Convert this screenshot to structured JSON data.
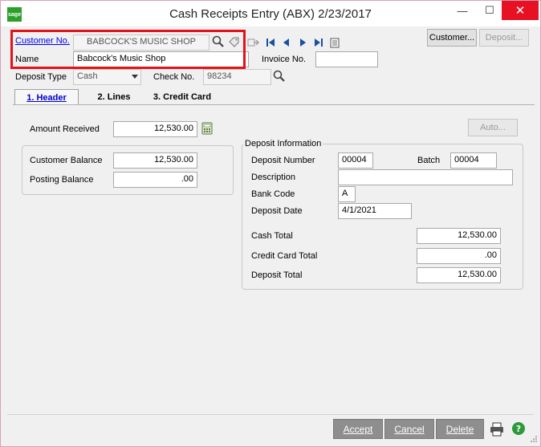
{
  "window": {
    "logo": "sage",
    "title": "Cash Receipts Entry (ABX) 2/23/2017",
    "min_glyph": "—",
    "max_glyph": "☐",
    "close_glyph": "✕"
  },
  "header": {
    "customer_no_label": "Customer No.",
    "customer_no_value": "BABCOCK'S MUSIC SHOP",
    "name_label": "Name",
    "name_value": "Babcock's Music Shop",
    "invoice_no_label": "Invoice No.",
    "invoice_no_value": "",
    "deposit_type_label": "Deposit Type",
    "deposit_type_value": "Cash",
    "check_no_label": "Check No.",
    "check_no_value": "98234",
    "customer_button": "Customer...",
    "deposit_button": "Deposit..."
  },
  "tabs": [
    {
      "label": "1. Header",
      "active": true
    },
    {
      "label": "2. Lines",
      "active": false
    },
    {
      "label": "3. Credit Card",
      "active": false
    }
  ],
  "main": {
    "amount_received_label": "Amount Received",
    "amount_received_value": "12,530.00",
    "auto_button": "Auto...",
    "customer_balance_label": "Customer Balance",
    "customer_balance_value": "12,530.00",
    "posting_balance_label": "Posting Balance",
    "posting_balance_value": ".00"
  },
  "deposit_info": {
    "title": "Deposit Information",
    "deposit_number_label": "Deposit Number",
    "deposit_number_value": "00004",
    "batch_label": "Batch",
    "batch_value": "00004",
    "description_label": "Description",
    "description_value": "",
    "bank_code_label": "Bank Code",
    "bank_code_value": "A",
    "deposit_date_label": "Deposit Date",
    "deposit_date_value": "4/1/2021",
    "cash_total_label": "Cash Total",
    "cash_total_value": "12,530.00",
    "credit_card_total_label": "Credit Card Total",
    "credit_card_total_value": ".00",
    "deposit_total_label": "Deposit Total",
    "deposit_total_value": "12,530.00"
  },
  "footer": {
    "accept": "Accept",
    "cancel": "Cancel",
    "delete": "Delete"
  },
  "colors": {
    "highlight": "#e4121a",
    "close": "#e81123",
    "sage": "#2aa02a",
    "nav": "#1a4fa0"
  }
}
